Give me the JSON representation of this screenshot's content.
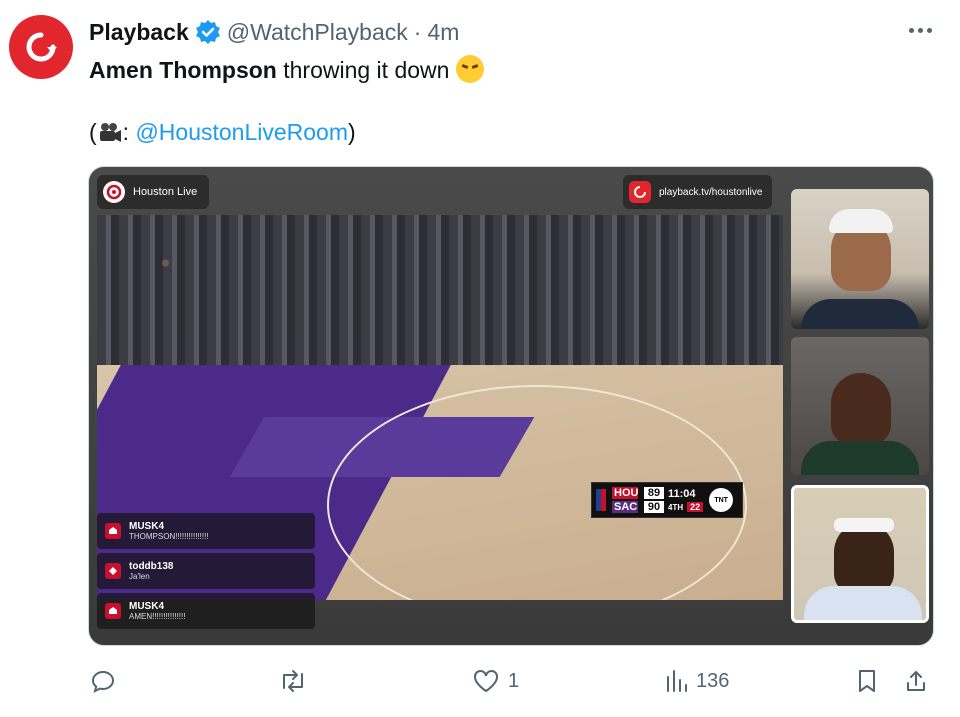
{
  "tweet": {
    "author_name": "Playback",
    "handle": "@WatchPlayback",
    "separator": "·",
    "time": "4m",
    "line1_bold": "Amen Thompson",
    "line1_rest": " throwing it down",
    "line2_open": "(",
    "line2_colon": ": ",
    "line2_mention": "@HoustonLiveRoom",
    "line2_close": ")"
  },
  "media": {
    "stream_label": "Houston Live",
    "url_label": "playback.tv/houstonlive",
    "scorebug": {
      "team1": "HOU",
      "score1": "89",
      "team2": "SAC",
      "score2": "90",
      "clock": "11:04",
      "period": "4TH",
      "shot_clock": "22",
      "network": "TNT"
    },
    "chat": [
      {
        "user": "MUSK4",
        "text": "THOMPSON!!!!!!!!!!!!!!!"
      },
      {
        "user": "toddb138",
        "text": "Ja'len"
      },
      {
        "user": "MUSK4",
        "text": "AMEN!!!!!!!!!!!!!!!"
      }
    ]
  },
  "actions": {
    "reply_count": "",
    "retweet_count": "",
    "like_count": "1",
    "views_count": "136"
  },
  "colors": {
    "brand_red": "#e1262d",
    "link_blue": "#1d9bf0",
    "verified_blue": "#1d9bf0",
    "muted_text": "#536471"
  }
}
